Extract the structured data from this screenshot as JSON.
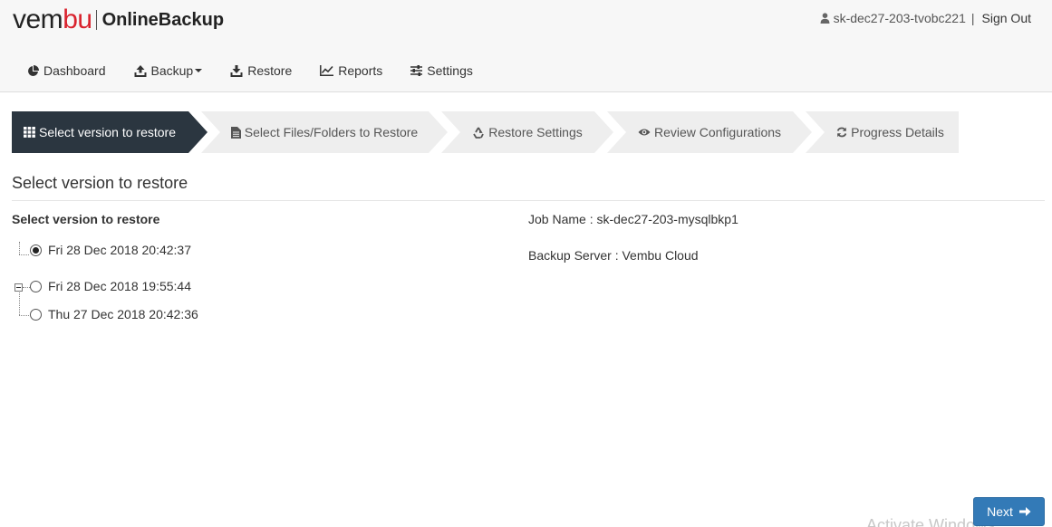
{
  "brand": {
    "logo_left": "vem",
    "logo_highlight": "bu",
    "product": "OnlineBackup"
  },
  "user": {
    "name": "sk-dec27-203-tvobc221",
    "separator": "|",
    "signout": "Sign Out"
  },
  "nav": {
    "dashboard": "Dashboard",
    "backup": "Backup",
    "restore": "Restore",
    "reports": "Reports",
    "settings": "Settings"
  },
  "wizard": {
    "steps": [
      {
        "label": "Select version to restore",
        "icon": "grid-icon",
        "active": true
      },
      {
        "label": "Select Files/Folders to Restore",
        "icon": "file-icon",
        "active": false
      },
      {
        "label": "Restore Settings",
        "icon": "recycle-icon",
        "active": false
      },
      {
        "label": "Review Configurations",
        "icon": "eye-icon",
        "active": false
      },
      {
        "label": "Progress Details",
        "icon": "refresh-icon",
        "active": false
      }
    ]
  },
  "main": {
    "section_title": "Select version to restore",
    "versions_label": "Select version to restore",
    "versions": [
      {
        "label": "Fri 28 Dec 2018 20:42:37",
        "selected": true
      },
      {
        "label": "Fri 28 Dec 2018 19:55:44",
        "selected": false
      },
      {
        "label": "Thu 27 Dec 2018 20:42:36",
        "selected": false
      }
    ],
    "job_name": "Job Name : sk-dec27-203-mysqlbkp1",
    "backup_server": "Backup Server : Vembu Cloud"
  },
  "footer": {
    "next": "Next"
  },
  "watermark": "Activate Windows",
  "colors": {
    "active_step": "#2b3640",
    "inactive_step": "#eeeeee",
    "primary": "#337ab7",
    "brand_red": "#d9232e"
  }
}
